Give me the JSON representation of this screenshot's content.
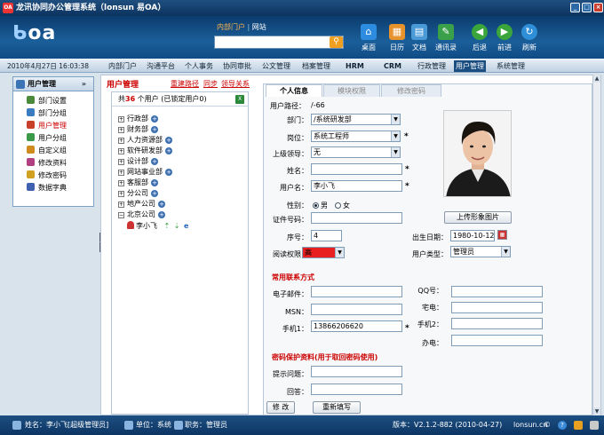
{
  "window": {
    "app_icon": "OA",
    "title": "龙讯协同办公管理系统（lonsun 易OA）"
  },
  "header": {
    "logo": "oa",
    "nav": [
      "内部门户",
      "网站"
    ],
    "search_placeholder": "",
    "toolbar": [
      {
        "label": "桌面",
        "icon": "home-icon",
        "color": "#2d8be0"
      },
      {
        "label": "日历",
        "icon": "calendar-icon",
        "color": "#e8922c"
      },
      {
        "label": "文档",
        "icon": "document-icon",
        "color": "#4a9ad8"
      },
      {
        "label": "通讯录",
        "icon": "contacts-icon",
        "color": "#3aa04a"
      },
      {
        "label": "后退",
        "icon": "back-icon",
        "color": "#3aa53a"
      },
      {
        "label": "前进",
        "icon": "forward-icon",
        "color": "#3aa53a"
      },
      {
        "label": "刷新",
        "icon": "refresh-icon",
        "color": "#2f8ed8"
      }
    ]
  },
  "menubar": {
    "datetime": "2010年4月27日 16:03:38",
    "items": [
      "内部门户",
      "沟通平台",
      "个人事务",
      "协同审批",
      "公文管理",
      "档案管理",
      "HRM",
      "CRM",
      "行政管理",
      "用户管理",
      "系统管理"
    ],
    "active": "用户管理"
  },
  "sidebar": {
    "title": "用户管理",
    "items": [
      {
        "label": "部门设置",
        "color": "#4a8a3a"
      },
      {
        "label": "部门分组",
        "color": "#3b7bc0"
      },
      {
        "label": "用户管理",
        "color": "#c8402a"
      },
      {
        "label": "用户分组",
        "color": "#3b9a4a"
      },
      {
        "label": "自定义组",
        "color": "#d08a20"
      },
      {
        "label": "修改资料",
        "color": "#b04080"
      },
      {
        "label": "修改密码",
        "color": "#d0a020"
      },
      {
        "label": "数据字典",
        "color": "#4060b0"
      }
    ],
    "active": "用户管理"
  },
  "page": {
    "title": "用户管理",
    "links": [
      "重建路径",
      "同步",
      "领导关系"
    ],
    "tree_summary": {
      "prefix": "共",
      "count": "36",
      "suffix": "个用户",
      "locked": "(已锁定用户0)"
    },
    "tree": [
      "行政部",
      "财务部",
      "人力资源部",
      "软件研发部",
      "设计部",
      "网站事业部",
      "客服部",
      "分公司",
      "地产公司",
      "北京公司"
    ],
    "tree_user": "李小飞"
  },
  "tabs": [
    "个人信息",
    "模块权限",
    "修改密码"
  ],
  "form": {
    "path_label": "用户路径：",
    "path_value": "/-66",
    "dept_label": "部门：",
    "dept_value": "/系统研发部",
    "post_label": "岗位：",
    "post_value": "系统工程师",
    "leader_label": "上级领导：",
    "leader_value": "无",
    "name_label": "姓名：",
    "name_value": "",
    "username_label": "用户名：",
    "username_value": "李小飞",
    "gender_label": "性别：",
    "gender_male": "男",
    "gender_female": "女",
    "idcard_label": "证件号码：",
    "idcard_value": "",
    "order_label": "序号：",
    "order_value": "4",
    "read_label": "阅读权限：",
    "read_value": "高",
    "read_color": "#e82020",
    "birth_label": "出生日期：",
    "birth_value": "1980-10-12",
    "usertype_label": "用户类型：",
    "usertype_value": "管理员",
    "upload_label": "上传形象图片",
    "required_mark": "*",
    "contact_title": "常用联系方式",
    "email_label": "电子邮件：",
    "qq_label": "QQ号：",
    "msn_label": "MSN：",
    "homephone_label": "宅电：",
    "mobile1_label": "手机1：",
    "mobile1_value": "13866206620",
    "mobile2_label": "手机2：",
    "office_label": "办电：",
    "security_title": "密码保护资料(用于取回密码使用)",
    "question_label": "提示问题：",
    "answer_label": "回答：",
    "submit_label": "修 改",
    "reset_label": "重新填写"
  },
  "statusbar": {
    "user": "姓名：李小飞[超级管理员]",
    "unit": "单位：系统",
    "post": "职务：管理员",
    "version": "版本：V2.1.2-882 (2010-04-27)",
    "site": "lonsun.cn"
  }
}
